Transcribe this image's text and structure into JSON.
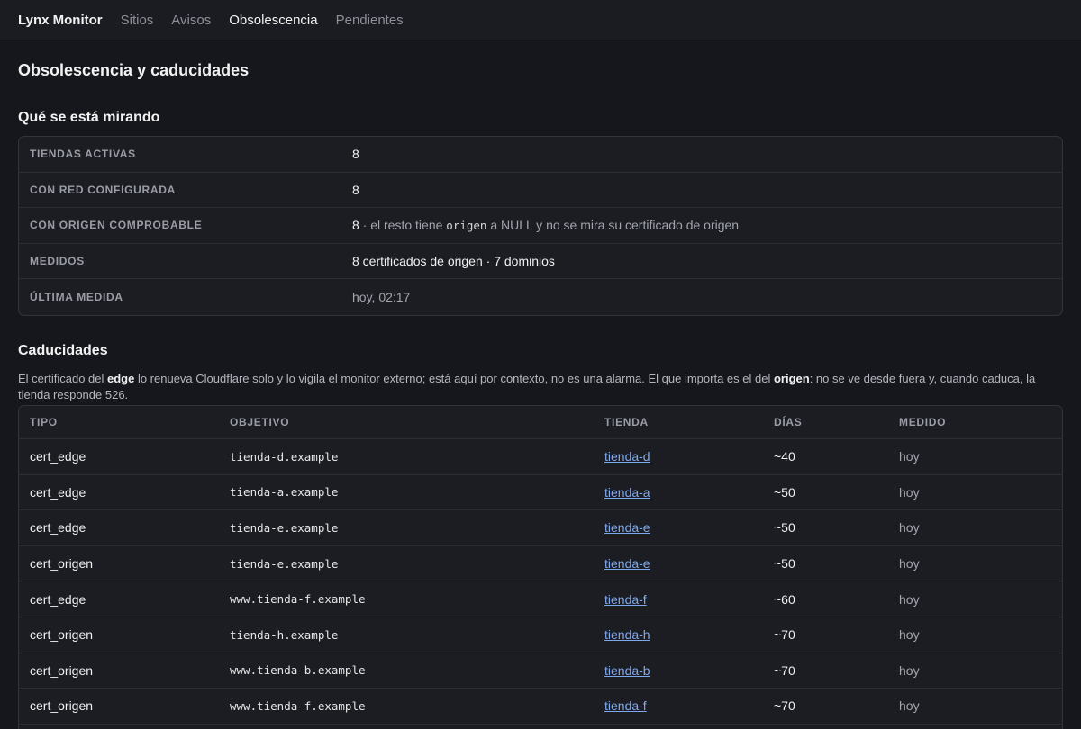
{
  "nav": {
    "brand": "Lynx Monitor",
    "links": [
      "Sitios",
      "Avisos",
      "Obsolescencia",
      "Pendientes"
    ],
    "active": "Obsolescencia"
  },
  "page_title": "Obsolescencia y caducidades",
  "summary": {
    "title": "Qué se está mirando",
    "rows": [
      {
        "label": "TIENDAS ACTIVAS",
        "value": "8"
      },
      {
        "label": "CON RED CONFIGURADA",
        "value": "8"
      },
      {
        "label": "CON ORIGEN COMPROBABLE",
        "value": "8",
        "note_pre": " · el resto tiene ",
        "note_code": "origen",
        "note_post": " a NULL y no se mira su certificado de origen"
      },
      {
        "label": "MEDIDOS",
        "value": "8 certificados de origen · 7 dominios"
      },
      {
        "label": "ÚLTIMA MEDIDA",
        "value": "hoy, 02:17"
      }
    ]
  },
  "expiries": {
    "title": "Caducidades",
    "note": {
      "p1": "El certificado del ",
      "b1": "edge",
      "p2": " lo renueva Cloudflare solo y lo vigila el monitor externo; está aquí por contexto, no es una alarma. El que importa es el del ",
      "b2": "origen",
      "p3": ": no se ve desde fuera y, cuando caduca, la tienda responde 526."
    },
    "columns": [
      "TIPO",
      "OBJETIVO",
      "TIENDA",
      "DÍAS",
      "MEDIDO"
    ],
    "rows": [
      {
        "tipo": "cert_edge",
        "objetivo": "tienda-d.example",
        "tienda": "tienda-d",
        "dias": "~40",
        "medido": "hoy"
      },
      {
        "tipo": "cert_edge",
        "objetivo": "tienda-a.example",
        "tienda": "tienda-a",
        "dias": "~50",
        "medido": "hoy"
      },
      {
        "tipo": "cert_edge",
        "objetivo": "tienda-e.example",
        "tienda": "tienda-e",
        "dias": "~50",
        "medido": "hoy"
      },
      {
        "tipo": "cert_origen",
        "objetivo": "tienda-e.example",
        "tienda": "tienda-e",
        "dias": "~50",
        "medido": "hoy"
      },
      {
        "tipo": "cert_edge",
        "objetivo": "www.tienda-f.example",
        "tienda": "tienda-f",
        "dias": "~60",
        "medido": "hoy"
      },
      {
        "tipo": "cert_origen",
        "objetivo": "tienda-h.example",
        "tienda": "tienda-h",
        "dias": "~70",
        "medido": "hoy"
      },
      {
        "tipo": "cert_origen",
        "objetivo": "www.tienda-b.example",
        "tienda": "tienda-b",
        "dias": "~70",
        "medido": "hoy"
      },
      {
        "tipo": "cert_origen",
        "objetivo": "www.tienda-f.example",
        "tienda": "tienda-f",
        "dias": "~70",
        "medido": "hoy"
      }
    ]
  }
}
